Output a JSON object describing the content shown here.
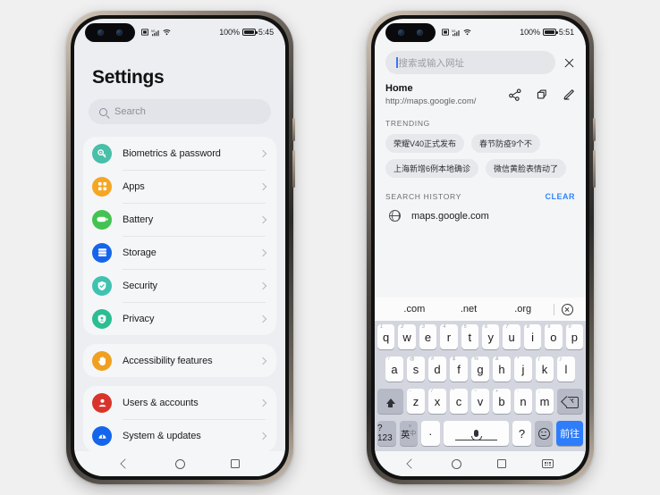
{
  "page": {
    "background_color": "#f0f0f0"
  },
  "phone_left": {
    "statusbar": {
      "battery_percent": "100%",
      "time": "5:45",
      "icons": [
        "sim-icon",
        "signal-icon",
        "wifi-icon"
      ]
    },
    "settings": {
      "title": "Settings",
      "search_placeholder": "Search",
      "groups": [
        {
          "items": [
            {
              "label": "Biometrics & password",
              "icon": "key-icon",
              "color": "#48bfa8"
            },
            {
              "label": "Apps",
              "icon": "grid-icon",
              "color": "#f5a623"
            },
            {
              "label": "Battery",
              "icon": "battery-icon",
              "color": "#44c352"
            },
            {
              "label": "Storage",
              "icon": "storage-icon",
              "color": "#1565ec"
            },
            {
              "label": "Security",
              "icon": "shield-check-icon",
              "color": "#3fc3b0"
            },
            {
              "label": "Privacy",
              "icon": "privacy-icon",
              "color": "#2bbd93"
            }
          ]
        },
        {
          "items": [
            {
              "label": "Accessibility features",
              "icon": "hand-icon",
              "color": "#f0a020"
            }
          ]
        },
        {
          "items": [
            {
              "label": "Users & accounts",
              "icon": "user-icon",
              "color": "#d9342b"
            },
            {
              "label": "System & updates",
              "icon": "system-icon",
              "color": "#1565ec"
            }
          ]
        }
      ]
    },
    "navbar": {
      "items": [
        "back-button",
        "home-button",
        "recents-button"
      ]
    }
  },
  "phone_right": {
    "statusbar": {
      "battery_percent": "100%",
      "time": "5:51",
      "icons": [
        "sim-icon",
        "signal-icon",
        "wifi-icon"
      ]
    },
    "browser": {
      "url_placeholder": "搜索或输入网址",
      "home": {
        "title": "Home",
        "url": "http://maps.google.com/",
        "actions": [
          "share-icon",
          "copy-icon",
          "edit-icon"
        ]
      },
      "trending": {
        "heading": "TRENDING",
        "tags": [
          "荣耀V40正式发布",
          "春节防疫9个不",
          "上海新增6例本地确诊",
          "微信黄脸表情动了"
        ]
      },
      "history": {
        "heading": "SEARCH HISTORY",
        "clear_label": "CLEAR",
        "entries": [
          {
            "text": "maps.google.com",
            "icon": "globe-icon"
          }
        ]
      }
    },
    "keyboard": {
      "suggestions": [
        ".com",
        ".net",
        ".org"
      ],
      "close_icon": "circle-x-icon",
      "row1": [
        {
          "key": "q",
          "hint": "1"
        },
        {
          "key": "w",
          "hint": "2"
        },
        {
          "key": "e",
          "hint": "3"
        },
        {
          "key": "r",
          "hint": "4"
        },
        {
          "key": "t",
          "hint": "5"
        },
        {
          "key": "y",
          "hint": "6"
        },
        {
          "key": "u",
          "hint": "7"
        },
        {
          "key": "i",
          "hint": "8"
        },
        {
          "key": "o",
          "hint": "9"
        },
        {
          "key": "p",
          "hint": "0"
        }
      ],
      "row2": [
        {
          "key": "a",
          "hint": "!"
        },
        {
          "key": "s",
          "hint": "@"
        },
        {
          "key": "d",
          "hint": "#"
        },
        {
          "key": "f",
          "hint": "$"
        },
        {
          "key": "g",
          "hint": "%"
        },
        {
          "key": "h",
          "hint": "&"
        },
        {
          "key": "j",
          "hint": "*"
        },
        {
          "key": "k",
          "hint": "("
        },
        {
          "key": "l",
          "hint": ")"
        }
      ],
      "row3": [
        {
          "key": "z",
          "hint": "-"
        },
        {
          "key": "x",
          "hint": "/"
        },
        {
          "key": "c",
          "hint": "\""
        },
        {
          "key": "v",
          "hint": "~"
        },
        {
          "key": "b",
          "hint": "+"
        },
        {
          "key": "n",
          "hint": ":"
        },
        {
          "key": "m",
          "hint": ";"
        }
      ],
      "shift_key": "shift-icon",
      "backspace_key": "backspace-icon",
      "symbols_key": "?123",
      "language_key_primary": "英",
      "language_key_secondary": "中",
      "period_key": "·",
      "space_key": "space-mic-icon",
      "question_key": "?",
      "emoji_key": "emoji-icon",
      "go_key": "前往"
    },
    "navbar": {
      "items": [
        "back-button",
        "home-button",
        "recents-button",
        "hide-keyboard-button"
      ]
    }
  }
}
